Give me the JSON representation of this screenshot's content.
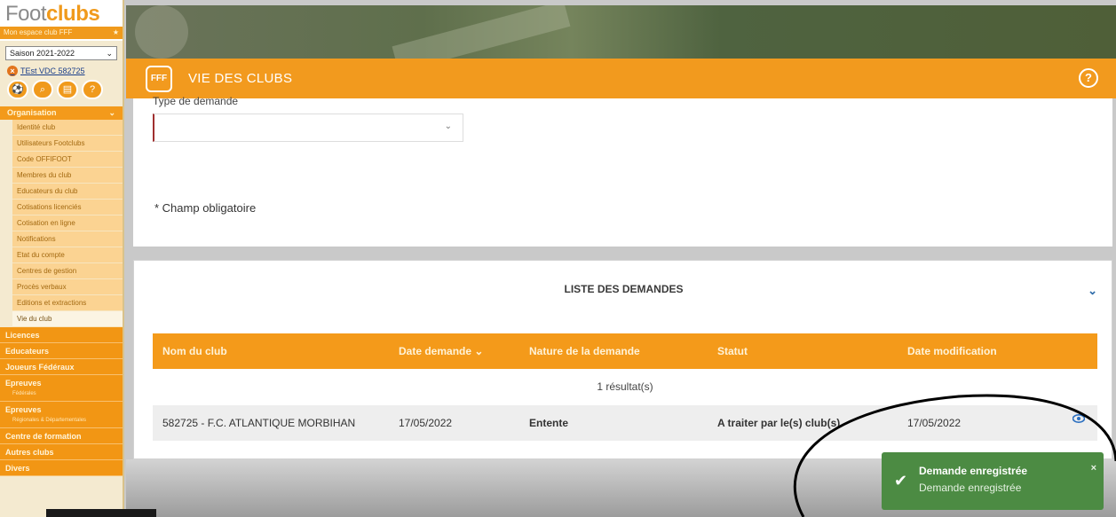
{
  "sidebar": {
    "logo_main": "Foot",
    "logo_accent": "clubs",
    "logo_sub": "Mon espace club FFF",
    "season": "Saison 2021-2022",
    "club_link": "TEst VDC 582725",
    "menu_head": "Organisation",
    "sub_items": [
      "Identité club",
      "Utilisateurs Footclubs",
      "Code OFFIFOOT",
      "Membres du club",
      "Educateurs du club",
      "Cotisations licenciés",
      "Cotisation en ligne",
      "Notifications",
      "Etat du compte",
      "Centres de gestion",
      "Procès verbaux",
      "Editions et extractions",
      "Vie du club"
    ],
    "sections": [
      {
        "label": "Licences",
        "sub": ""
      },
      {
        "label": "Educateurs",
        "sub": ""
      },
      {
        "label": "Joueurs Fédéraux",
        "sub": ""
      },
      {
        "label": "Epreuves",
        "sub": "Fédérales"
      },
      {
        "label": "Epreuves",
        "sub": "Régionales & Départementales"
      },
      {
        "label": "Centre de formation",
        "sub": ""
      },
      {
        "label": "Autres clubs",
        "sub": ""
      },
      {
        "label": "Divers",
        "sub": ""
      }
    ]
  },
  "header": {
    "logo_text": "FFF",
    "title": "VIE DES CLUBS",
    "help": "?"
  },
  "form": {
    "type_label": "Type de demande",
    "select_chevron": "⌄",
    "required_note": "* Champ obligatoire"
  },
  "list": {
    "title": "LISTE DES DEMANDES",
    "toggle": "⌄",
    "columns": [
      "Nom du club",
      "Date demande",
      "Nature de la demande",
      "Statut",
      "Date modification"
    ],
    "sort_icon": "⌄",
    "results": "1 résultat(s)",
    "rows": [
      {
        "club": "582725 - F.C. ATLANTIQUE MORBIHAN",
        "date_demande": "17/05/2022",
        "nature": "Entente",
        "statut": "A traiter par le(s) club(s)",
        "date_modification": "17/05/2022"
      }
    ]
  },
  "toast": {
    "title": "Demande enregistrée",
    "message": "Demande enregistrée",
    "close": "×"
  },
  "colors": {
    "accent": "#f29a1e",
    "toast_bg": "#4c8b43",
    "link": "#2c6aa8"
  }
}
